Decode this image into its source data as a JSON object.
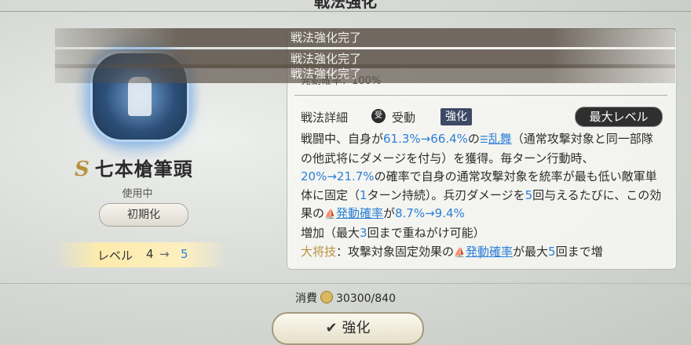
{
  "header": {
    "title": "戦法強化"
  },
  "toasts": [
    "戦法強化完了",
    "戦法強化完了",
    "戦法強化完了"
  ],
  "left": {
    "grade": "S",
    "skill_name": "七本槍筆頭",
    "status": "使用中",
    "reset_label": "初期化",
    "level_label": "レベル",
    "level_current": "4",
    "level_next": "5"
  },
  "panel": {
    "trigger_rate": "発動確率：100%",
    "detail_title": "戦法詳細",
    "passive_icon_char": "受",
    "passive_label": "受動",
    "tag": "強化",
    "max_level_label": "最大レベル",
    "desc": {
      "s1": "戦闘中、自身が",
      "v1": "61.3%→66.4%",
      "s2": "の",
      "effect1": "乱舞",
      "s3": "（通常攻撃対象と同一部隊の他武将にダメージを付与）を獲得。毎ターン行動時、",
      "v2": "20%→21.7%",
      "s4": "の確率で自身の通常攻撃対象を統率が最も低い敵軍単体に固定（",
      "v3": "1",
      "s5": "ターン持続）。兵刃ダメージを",
      "v4": "5",
      "s6": "回与えるたびに、この効果の",
      "effect2": "発動確率",
      "s7": "が",
      "v5": "8.7%→9.4%",
      "s8": "増加（最大",
      "v6": "3",
      "s9": "回まで重ねがけ可能）",
      "general_label": "大将技",
      "s10": "：攻撃対象固定効果の",
      "effect3": "発動確率",
      "s11": "が最大",
      "v7": "5",
      "s12": "回まで増"
    }
  },
  "footer": {
    "cost_label": "消費",
    "cost_value": "30300/840",
    "enhance_label": "強化"
  },
  "colors": {
    "accent_blue": "#2c7fd6",
    "gold": "#b8913a",
    "tag_bg": "#3d4a66"
  }
}
